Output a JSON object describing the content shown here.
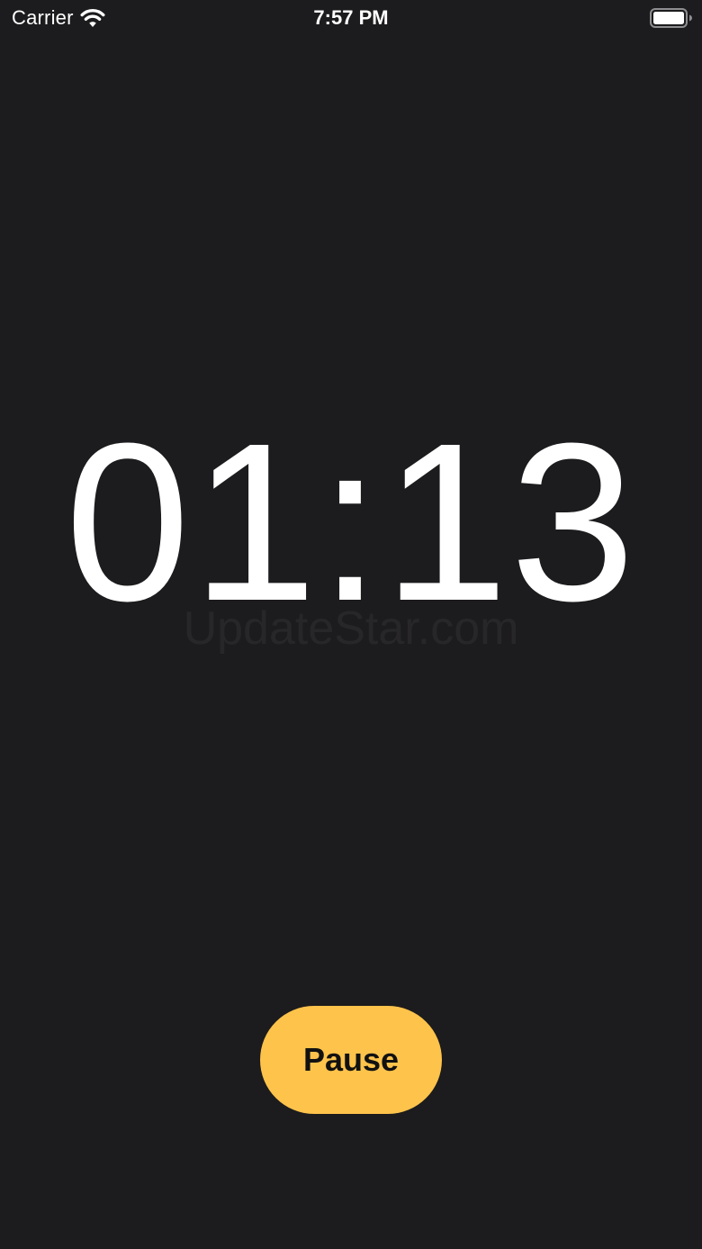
{
  "status_bar": {
    "carrier": "Carrier",
    "time": "7:57 PM",
    "wifi_icon": "wifi-icon",
    "battery_icon": "battery-icon",
    "battery_level": 1.0
  },
  "timer": {
    "display": "01:13"
  },
  "watermark": {
    "text": "UpdateStar.com"
  },
  "controls": {
    "pause_label": "Pause"
  },
  "colors": {
    "background": "#1c1b1d",
    "accent": "#fec34b",
    "text": "#ffffff"
  }
}
